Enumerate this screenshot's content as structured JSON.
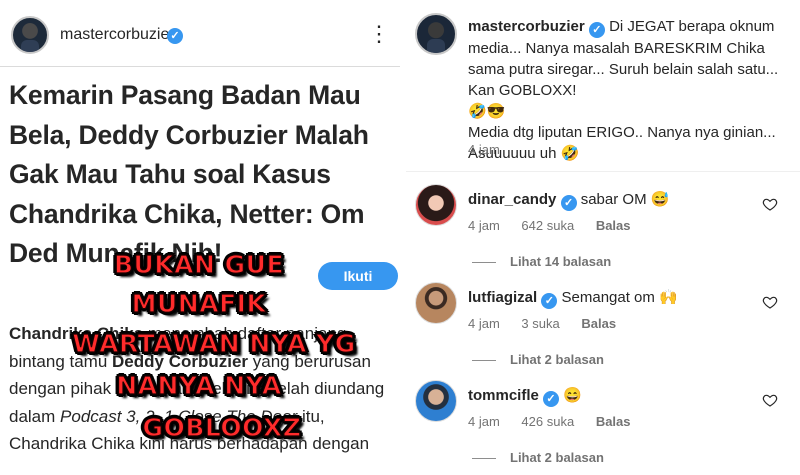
{
  "left": {
    "username": "mastercorbuzier",
    "more_icon": "⋮",
    "headline": "Kemarin Pasang Badan Mau Bela, Deddy Corbuzier Malah Gak Mau Tahu soal Kasus Chandrika Chika, Netter: Om Ded Munafik Nih!",
    "follow_label": "Ikuti",
    "article_bold": "Chandrika Chika",
    "article_p1": " menambah daftar panjang bintang tamu ",
    "article_bold2": "Deddy Corbuzier",
    "article_p2": " yang berurusan dengan pihak kepolisian. Sehari setelah diundang dalam ",
    "article_italic": "Podcast 3, 2, 1 Close The Door",
    "article_p3": " itu, Chandrika Chika kini harus berhadapan dengan",
    "meme_lines": [
      "BUKAN GUE",
      "MUNAFIK",
      "WARTAWAN NYA YG",
      "NANYA NYA",
      "GOBLOOXZ"
    ]
  },
  "right": {
    "caption_user": "mastercorbuzier",
    "caption_text": "Di JEGAT berapa oknum media... Nanya masalah BARESKRIM Chika sama putra siregar... Suruh belain salah satu... Kan GOBLOXX!",
    "caption_emojis": "🤣😎",
    "caption_text2": "Media dtg liputan ERIGO.. Nanya nya ginian... Asuuuuuu uh 🤣",
    "caption_time": "4 jam",
    "comments": [
      {
        "user": "dinar_candy",
        "text": "sabar OM 😅",
        "time": "4 jam",
        "likes": "642 suka",
        "reply": "Balas",
        "view_replies": "Lihat 14 balasan"
      },
      {
        "user": "lutfiagizal",
        "text": "Semangat om 🙌",
        "time": "4 jam",
        "likes": "3 suka",
        "reply": "Balas",
        "view_replies": "Lihat 2 balasan"
      },
      {
        "user": "tommcifle",
        "text": "😄",
        "time": "4 jam",
        "likes": "426 suka",
        "reply": "Balas",
        "view_replies": "Lihat 2 balasan"
      }
    ]
  },
  "colors": {
    "accent": "#3797f0",
    "meme_text": "#ff2b2b",
    "muted": "#737373"
  },
  "icons": {
    "verified": "verified-badge-icon",
    "more": "more-options-icon",
    "like": "heart-icon"
  }
}
